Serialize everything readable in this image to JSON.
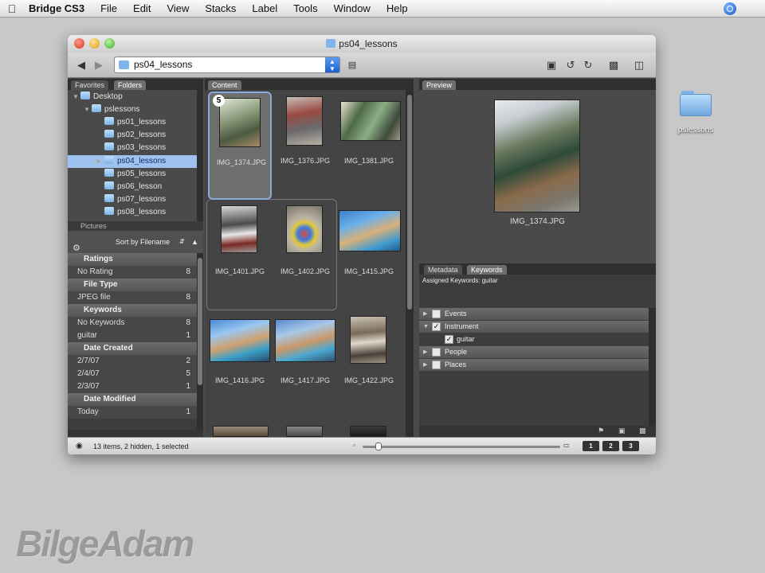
{
  "menubar": {
    "app_name": "Bridge CS3",
    "items": [
      "File",
      "Edit",
      "View",
      "Stacks",
      "Label",
      "Tools",
      "Window",
      "Help"
    ]
  },
  "desktop": {
    "folder_label": "pslessons"
  },
  "window": {
    "title": "ps04_lessons",
    "path_value": "ps04_lessons"
  },
  "left_panel": {
    "tabs": [
      "Favorites",
      "Folders"
    ],
    "tree": [
      {
        "label": "Desktop",
        "level": 0
      },
      {
        "label": "pslessons",
        "level": 1
      },
      {
        "label": "ps01_lessons",
        "level": 2
      },
      {
        "label": "ps02_lessons",
        "level": 2
      },
      {
        "label": "ps03_lessons",
        "level": 2
      },
      {
        "label": "ps04_lessons",
        "level": 2,
        "selected": true
      },
      {
        "label": "ps05_lessons",
        "level": 2
      },
      {
        "label": "ps06_lesson",
        "level": 2
      },
      {
        "label": "ps07_lessons",
        "level": 2
      },
      {
        "label": "ps08_lessons",
        "level": 2
      }
    ],
    "pictures_label": "Pictures",
    "sort_label": "Sort by Filename",
    "filters": [
      {
        "heading": "Ratings",
        "rows": [
          {
            "label": "No Rating",
            "count": "8"
          }
        ]
      },
      {
        "heading": "File Type",
        "rows": [
          {
            "label": "JPEG file",
            "count": "8"
          }
        ]
      },
      {
        "heading": "Keywords",
        "rows": [
          {
            "label": "No Keywords",
            "count": "8"
          },
          {
            "label": "guitar",
            "count": "1"
          }
        ]
      },
      {
        "heading": "Date Created",
        "rows": [
          {
            "label": "2/7/07",
            "count": "2"
          },
          {
            "label": "2/4/07",
            "count": "5"
          },
          {
            "label": "2/3/07",
            "count": "1"
          }
        ]
      },
      {
        "heading": "Date Modified",
        "rows": [
          {
            "label": "Today",
            "count": "1"
          }
        ]
      }
    ]
  },
  "content": {
    "tab": "Content",
    "stack_count": "5",
    "items": [
      {
        "name": "IMG_1374.JPG"
      },
      {
        "name": "IMG_1376.JPG"
      },
      {
        "name": "IMG_1381.JPG"
      },
      {
        "name": "IMG_1401.JPG"
      },
      {
        "name": "IMG_1402.JPG"
      },
      {
        "name": "IMG_1415.JPG"
      },
      {
        "name": "IMG_1416.JPG"
      },
      {
        "name": "IMG_1417.JPG"
      },
      {
        "name": "IMG_1422.JPG"
      }
    ]
  },
  "preview": {
    "tab": "Preview",
    "caption": "IMG_1374.JPG"
  },
  "keywords_panel": {
    "tabs": [
      "Metadata",
      "Keywords"
    ],
    "assigned": "Assigned Keywords: guitar",
    "rows": [
      {
        "label": "Events",
        "group": true,
        "checked": false
      },
      {
        "label": "Instrument",
        "group": true,
        "checked": true
      },
      {
        "label": "guitar",
        "group": false,
        "checked": true
      },
      {
        "label": "People",
        "group": true,
        "checked": false
      },
      {
        "label": "Places",
        "group": true,
        "checked": false
      }
    ]
  },
  "status": {
    "text": "13 items, 2 hidden, 1 selected",
    "view_buttons": [
      "1",
      "2",
      "3"
    ]
  },
  "watermark": "BilgeAdam"
}
